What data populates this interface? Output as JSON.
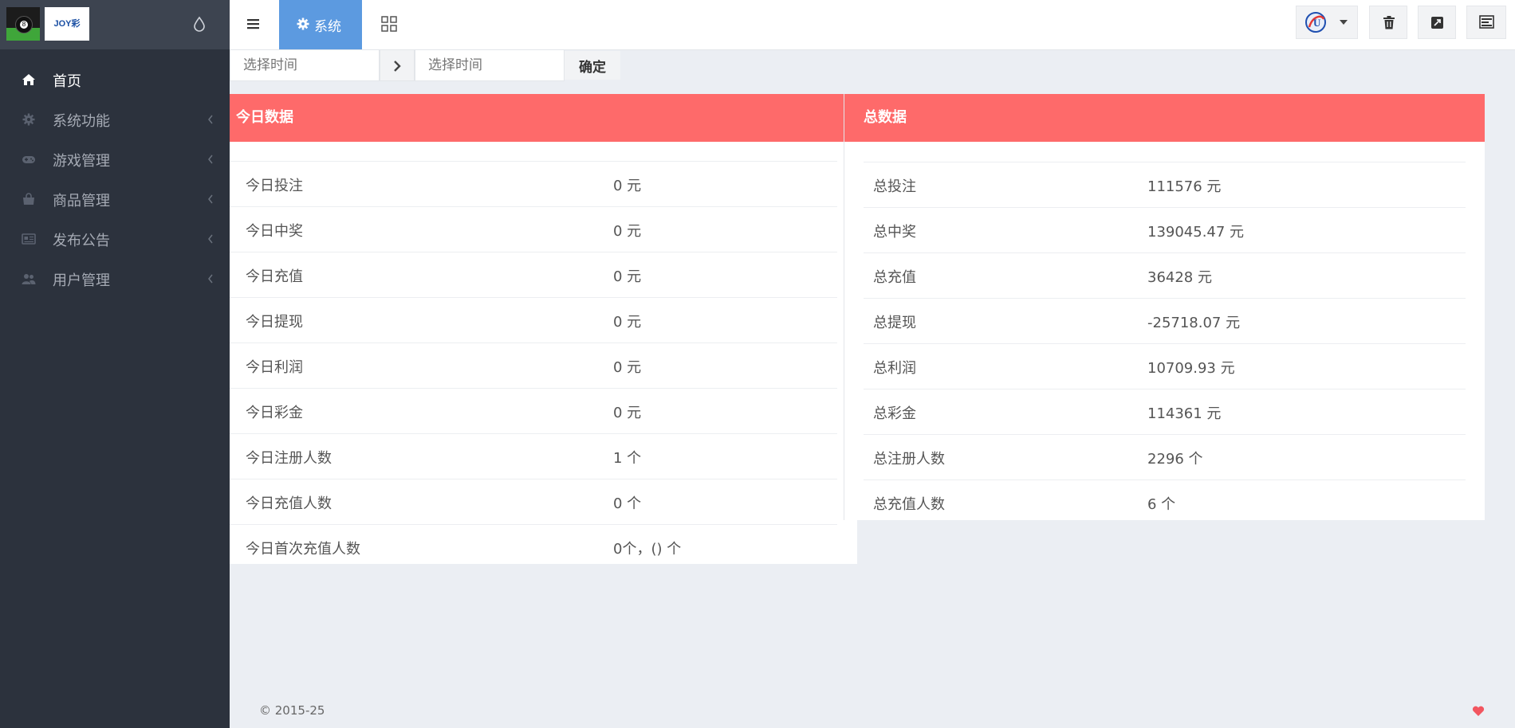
{
  "brand": {
    "logo_text": "JOY彩",
    "ball_number": "8"
  },
  "sidebar": {
    "items": [
      {
        "label": "首页",
        "icon": "home-icon"
      },
      {
        "label": "系统功能",
        "icon": "gear-icon"
      },
      {
        "label": "游戏管理",
        "icon": "gamepad-icon"
      },
      {
        "label": "商品管理",
        "icon": "shopping-bag-icon"
      },
      {
        "label": "发布公告",
        "icon": "newspaper-icon"
      },
      {
        "label": "用户管理",
        "icon": "users-icon"
      }
    ]
  },
  "topbar": {
    "active_tab": "系统"
  },
  "filter": {
    "start_placeholder": "选择时间",
    "end_placeholder": "选择时间",
    "confirm_label": "确定"
  },
  "today": {
    "title": "今日数据",
    "rows": [
      {
        "label": "今日投注",
        "value": "0 元"
      },
      {
        "label": "今日中奖",
        "value": "0 元"
      },
      {
        "label": "今日充值",
        "value": "0 元"
      },
      {
        "label": "今日提现",
        "value": "0 元"
      },
      {
        "label": "今日利润",
        "value": "0 元"
      },
      {
        "label": "今日彩金",
        "value": "0 元"
      },
      {
        "label": "今日注册人数",
        "value": "1 个"
      },
      {
        "label": "今日充值人数",
        "value": "0 个"
      },
      {
        "label": "今日首次充值人数",
        "value": "0个，() 个"
      }
    ]
  },
  "total": {
    "title": "总数据",
    "rows": [
      {
        "label": "总投注",
        "value": "111576 元"
      },
      {
        "label": "总中奖",
        "value": "139045.47 元"
      },
      {
        "label": "总充值",
        "value": "36428 元"
      },
      {
        "label": "总提现",
        "value": "-25718.07 元"
      },
      {
        "label": "总利润",
        "value": "10709.93 元"
      },
      {
        "label": "总彩金",
        "value": "114361 元"
      },
      {
        "label": "总注册人数",
        "value": "2296 个"
      },
      {
        "label": "总充值人数",
        "value": "6 个"
      }
    ]
  },
  "footer": {
    "copyright": "© 2015-25"
  },
  "colors": {
    "sidebar_bg": "#2c323d",
    "accent_tab": "#5c9ae0",
    "card_header": "#fe6a6a",
    "heart": "#f2555f"
  }
}
